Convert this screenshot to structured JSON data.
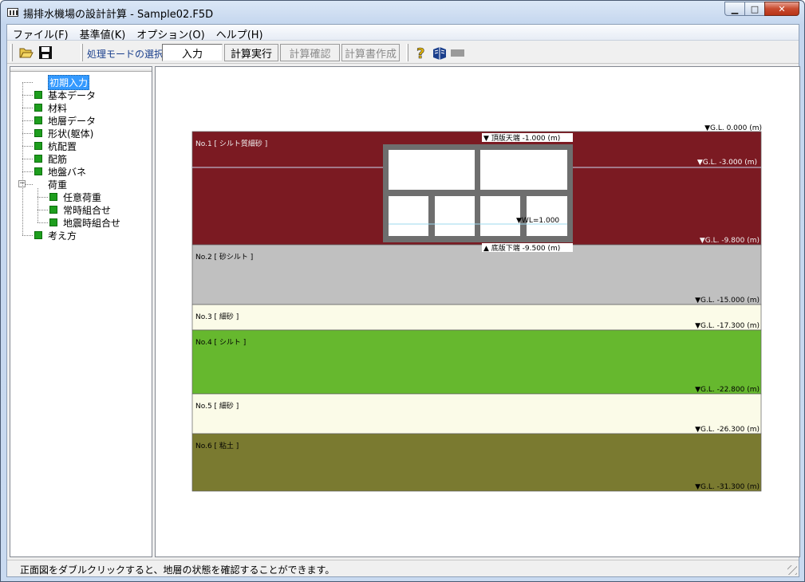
{
  "window": {
    "title": "揚排水機場の設計計算 - Sample02.F5D",
    "minimize_glyph": "▁",
    "maximize_glyph": "□",
    "close_glyph": "✕"
  },
  "menu": [
    "ファイル(F)",
    "基準値(K)",
    "オプション(O)",
    "ヘルプ(H)"
  ],
  "toolbar": {
    "open_icon": "folder-open-icon",
    "save_icon": "save-icon",
    "mode_label": "処理モードの選択",
    "modes": [
      {
        "label": "入力",
        "state": "selected"
      },
      {
        "label": "計算実行",
        "state": "enabled"
      },
      {
        "label": "計算確認",
        "state": "disabled"
      },
      {
        "label": "計算書作成",
        "state": "disabled"
      }
    ],
    "help_glyph": "?",
    "help_icon": "help-icon",
    "book_icon": "book-icon",
    "disabled_icon": "gray-bar-icon"
  },
  "tree": [
    {
      "label": "初期入力",
      "level": 0,
      "selected": true,
      "icon": "none"
    },
    {
      "label": "基本データ",
      "level": 0
    },
    {
      "label": "材料",
      "level": 0
    },
    {
      "label": "地層データ",
      "level": 0
    },
    {
      "label": "形状(躯体)",
      "level": 0
    },
    {
      "label": "杭配置",
      "level": 0
    },
    {
      "label": "配筋",
      "level": 0
    },
    {
      "label": "地盤バネ",
      "level": 0
    },
    {
      "label": "荷重",
      "level": 0,
      "expanded": true,
      "icon": "none",
      "expander": "−"
    },
    {
      "label": "任意荷重",
      "level": 1
    },
    {
      "label": "常時組合せ",
      "level": 1
    },
    {
      "label": "地震時組合せ",
      "level": 1
    },
    {
      "label": "考え方",
      "level": 0
    }
  ],
  "section": {
    "gl_label": "▼G.L. 0.000 (m)",
    "layers": [
      {
        "label": "No.1 [ シルト質細砂 ]",
        "bottom": "▼G.L. -9.800 (m)",
        "color": "#7b1a22"
      },
      {
        "label": "No.2 [ 砂シルト ]",
        "bottom": "▼G.L. -15.000 (m)",
        "color": "#c0c0c0"
      },
      {
        "label": "No.3 [ 細砂 ]",
        "bottom": "▼G.L. -17.300 (m)",
        "color": "#fbfbe8"
      },
      {
        "label": "No.4 [ シルト ]",
        "bottom": "▼G.L. -22.800 (m)",
        "color": "#66b82e"
      },
      {
        "label": "No.5 [ 細砂 ]",
        "bottom": "▼G.L. -26.300 (m)",
        "color": "#fbfbe8"
      },
      {
        "label": "No.6 [ 粘土 ]",
        "bottom": "▼G.L. -31.300 (m)",
        "color": "#7a7a30"
      }
    ],
    "water_level_label": "▼G.L. -3.000 (m)",
    "top_slab_label": "▼ 頂版天端 -1.000 (m)",
    "bottom_slab_label": "▲ 底版下端 -9.500 (m)",
    "wl_label": "▼WL=1.000"
  },
  "status": "正面図をダブルクリックすると、地層の状態を確認することができます。"
}
